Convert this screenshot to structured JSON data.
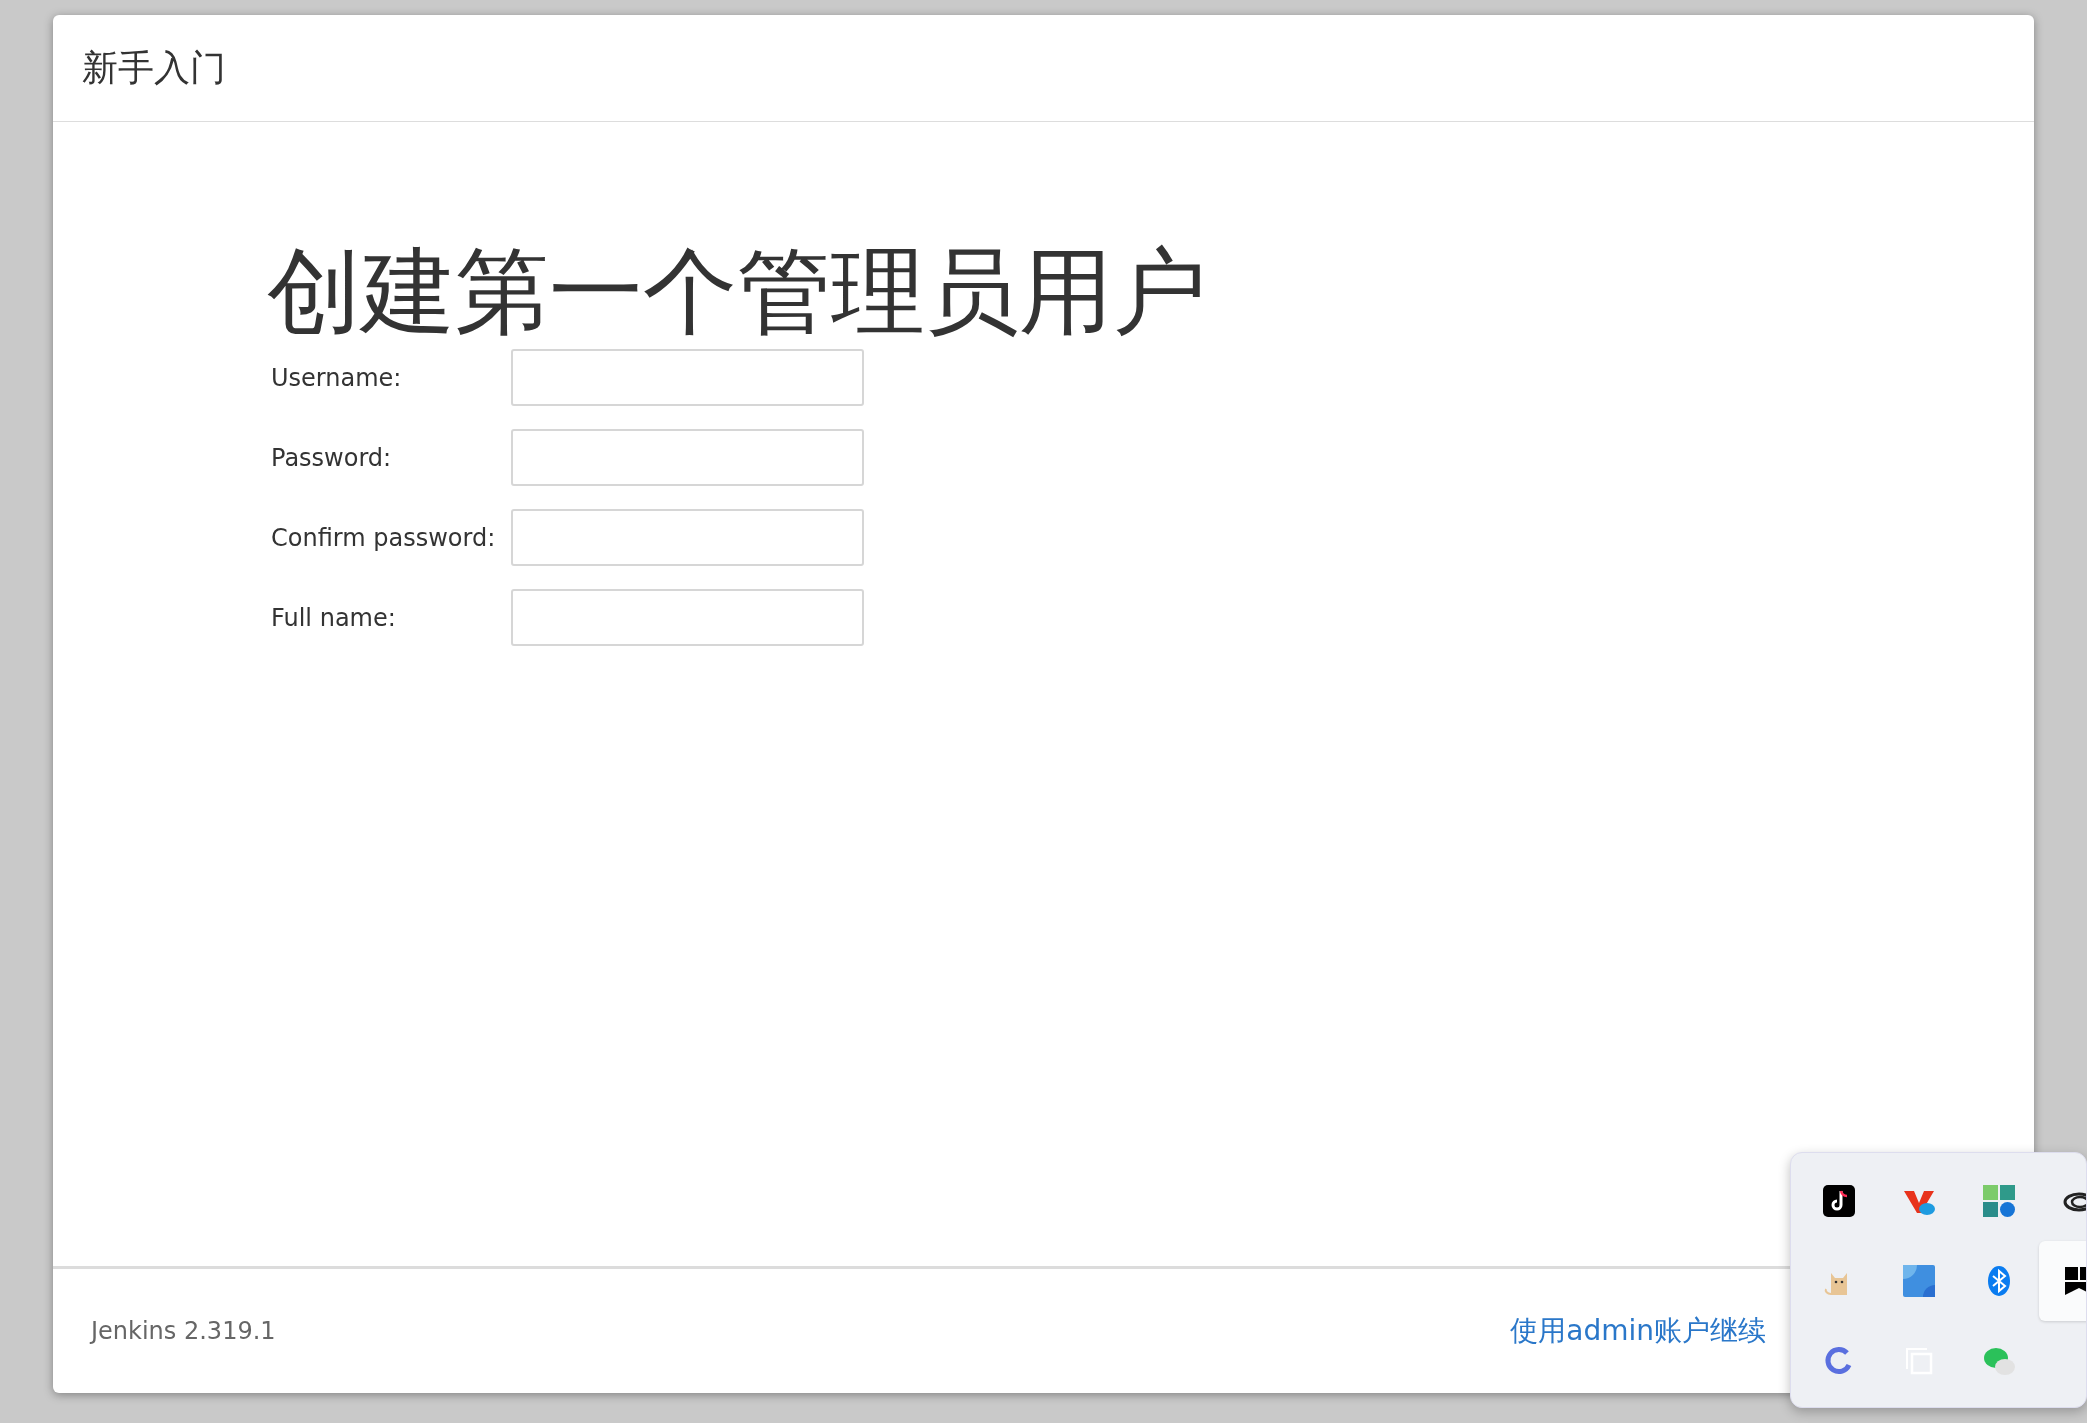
{
  "dialog": {
    "title": "新手入门",
    "heading": "创建第一个管理员用户",
    "fields": [
      {
        "label": "Username:"
      },
      {
        "label": "Password:"
      },
      {
        "label": "Confirm password:"
      },
      {
        "label": "Full name:"
      }
    ],
    "footer": {
      "version": "Jenkins 2.319.1",
      "link": "使用admin账户继续"
    }
  },
  "tray": {
    "icons": [
      {
        "kind": "music-note",
        "selected": false
      },
      {
        "kind": "v-logo",
        "selected": false
      },
      {
        "kind": "tiles",
        "selected": false
      },
      {
        "kind": "cloud-rings",
        "selected": false
      },
      {
        "kind": "cat",
        "selected": false
      },
      {
        "kind": "blue-square",
        "selected": false
      },
      {
        "kind": "bluetooth",
        "selected": false
      },
      {
        "kind": "flag",
        "selected": true
      },
      {
        "kind": "ring",
        "selected": false
      },
      {
        "kind": "copy",
        "selected": false
      },
      {
        "kind": "chat",
        "selected": false
      }
    ]
  }
}
